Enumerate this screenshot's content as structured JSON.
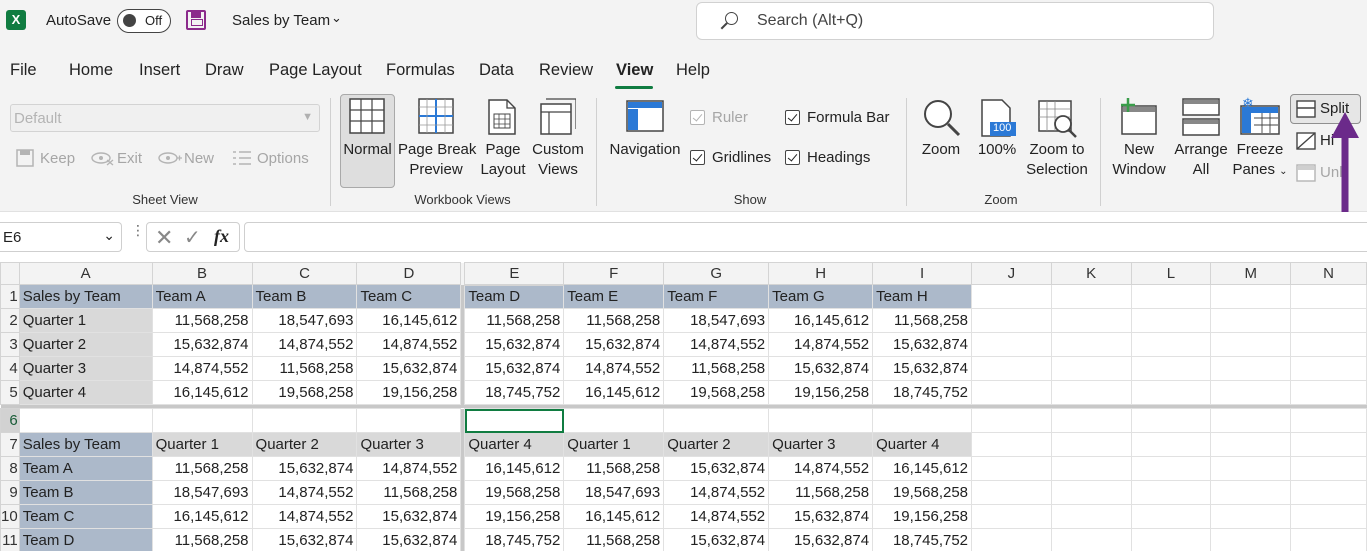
{
  "titlebar": {
    "app_logo": "X",
    "autosave_label": "AutoSave",
    "autosave_state": "Off",
    "doc_title": "Sales by Team",
    "search_placeholder": "Search (Alt+Q)"
  },
  "tabs": [
    "File",
    "Home",
    "Insert",
    "Draw",
    "Page Layout",
    "Formulas",
    "Data",
    "Review",
    "View",
    "Help"
  ],
  "active_tab": "View",
  "ribbon": {
    "sheet_view": {
      "combo_value": "Default",
      "keep": "Keep",
      "exit": "Exit",
      "new": "New",
      "options": "Options",
      "label": "Sheet View"
    },
    "workbook_views": {
      "normal": "Normal",
      "page_break_1": "Page Break",
      "page_break_2": "Preview",
      "page_layout_1": "Page",
      "page_layout_2": "Layout",
      "custom_1": "Custom",
      "custom_2": "Views",
      "label": "Workbook Views"
    },
    "show": {
      "navigation": "Navigation",
      "ruler": "Ruler",
      "formula_bar": "Formula Bar",
      "gridlines": "Gridlines",
      "headings": "Headings",
      "label": "Show"
    },
    "zoom": {
      "zoom": "Zoom",
      "hundred": "100%",
      "hundred_badge": "100",
      "sel_1": "Zoom to",
      "sel_2": "Selection",
      "label": "Zoom"
    },
    "window": {
      "new_1": "New",
      "new_2": "Window",
      "arrange_1": "Arrange",
      "arrange_2": "All",
      "freeze_1": "Freeze",
      "freeze_2": "Panes",
      "split": "Split",
      "hide": "Hi",
      "unhide": "Unh"
    }
  },
  "formula_bar": {
    "name_box": "E6",
    "fx": "fx",
    "value": ""
  },
  "grid": {
    "columns": [
      "A",
      "B",
      "C",
      "D",
      "E",
      "F",
      "G",
      "H",
      "I",
      "J",
      "K",
      "L",
      "M",
      "N"
    ],
    "top": {
      "rows": [
        "1",
        "2",
        "3",
        "4",
        "5"
      ],
      "header": [
        "Sales by Team",
        "Team A",
        "Team B",
        "Team C",
        "Team D",
        "Team E",
        "Team F",
        "Team G",
        "Team H"
      ],
      "data": [
        [
          "Quarter 1",
          "11,568,258",
          "18,547,693",
          "16,145,612",
          "11,568,258",
          "11,568,258",
          "18,547,693",
          "16,145,612",
          "11,568,258"
        ],
        [
          "Quarter 2",
          "15,632,874",
          "14,874,552",
          "14,874,552",
          "15,632,874",
          "15,632,874",
          "14,874,552",
          "14,874,552",
          "15,632,874"
        ],
        [
          "Quarter 3",
          "14,874,552",
          "11,568,258",
          "15,632,874",
          "15,632,874",
          "14,874,552",
          "11,568,258",
          "15,632,874",
          "15,632,874"
        ],
        [
          "Quarter 4",
          "16,145,612",
          "19,568,258",
          "19,156,258",
          "18,745,752",
          "16,145,612",
          "19,568,258",
          "19,156,258",
          "18,745,752"
        ]
      ]
    },
    "bottom": {
      "rows": [
        "6",
        "7",
        "8",
        "9",
        "10",
        "11"
      ],
      "header": [
        "Sales by Team",
        "Quarter 1",
        "Quarter 2",
        "Quarter 3",
        "Quarter 4",
        "Quarter 1",
        "Quarter 2",
        "Quarter 3",
        "Quarter 4"
      ],
      "data": [
        [
          "Team A",
          "11,568,258",
          "15,632,874",
          "14,874,552",
          "16,145,612",
          "11,568,258",
          "15,632,874",
          "14,874,552",
          "16,145,612"
        ],
        [
          "Team B",
          "18,547,693",
          "14,874,552",
          "11,568,258",
          "19,568,258",
          "18,547,693",
          "14,874,552",
          "11,568,258",
          "19,568,258"
        ],
        [
          "Team C",
          "16,145,612",
          "14,874,552",
          "15,632,874",
          "19,156,258",
          "16,145,612",
          "14,874,552",
          "15,632,874",
          "19,156,258"
        ],
        [
          "Team D",
          "11,568,258",
          "15,632,874",
          "15,632,874",
          "18,745,752",
          "11,568,258",
          "15,632,874",
          "15,632,874",
          "18,745,752"
        ]
      ]
    }
  },
  "colors": {
    "excel_green": "#107c41",
    "header_blue": "#acb9ca",
    "header_grey": "#d9d9d9",
    "arrow_purple": "#6b2a8a"
  }
}
